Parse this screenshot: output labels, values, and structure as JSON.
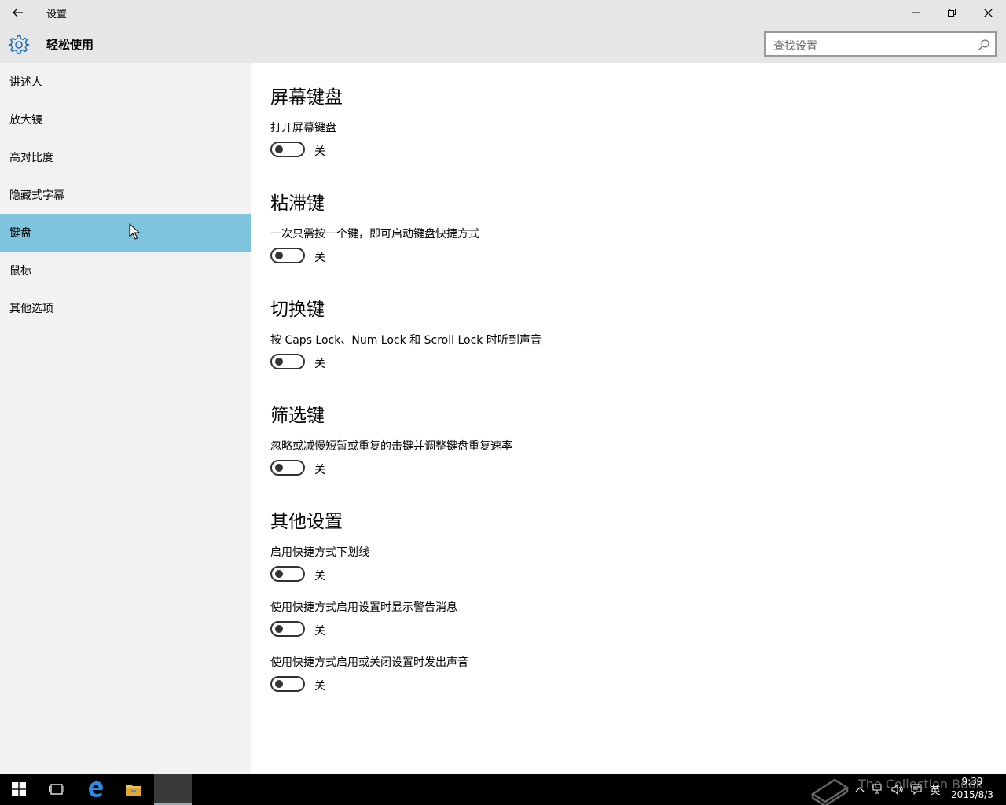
{
  "window": {
    "title": "设置",
    "controls": {
      "minimize": "minimize-icon",
      "maximize": "restore-icon",
      "close": "close-icon"
    }
  },
  "header": {
    "title": "轻松使用",
    "search_placeholder": "查找设置"
  },
  "sidebar": {
    "items": [
      {
        "label": "讲述人",
        "selected": false
      },
      {
        "label": "放大镜",
        "selected": false
      },
      {
        "label": "高对比度",
        "selected": false
      },
      {
        "label": "隐藏式字幕",
        "selected": false
      },
      {
        "label": "键盘",
        "selected": true
      },
      {
        "label": "鼠标",
        "selected": false
      },
      {
        "label": "其他选项",
        "selected": false
      }
    ]
  },
  "content": {
    "sections": [
      {
        "title": "屏幕键盘",
        "options": [
          {
            "label": "打开屏幕键盘",
            "state": "关"
          }
        ]
      },
      {
        "title": "粘滞键",
        "options": [
          {
            "label": "一次只需按一个键，即可启动键盘快捷方式",
            "state": "关"
          }
        ]
      },
      {
        "title": "切换键",
        "options": [
          {
            "label": "按 Caps Lock、Num Lock 和 Scroll Lock 时听到声音",
            "state": "关"
          }
        ]
      },
      {
        "title": "筛选键",
        "options": [
          {
            "label": "忽略或减慢短暂或重复的击键并调整键盘重复速率",
            "state": "关"
          }
        ]
      },
      {
        "title": "其他设置",
        "options": [
          {
            "label": "启用快捷方式下划线",
            "state": "关"
          },
          {
            "label": "使用快捷方式启用设置时显示警告消息",
            "state": "关"
          },
          {
            "label": "使用快捷方式启用或关闭设置时发出声音",
            "state": "关"
          }
        ]
      }
    ]
  },
  "taskbar": {
    "clock_time": "9:39",
    "clock_date": "2015/8/3",
    "ime": "英",
    "watermark": "The Collection Book"
  },
  "colors": {
    "titlebar_bg": "#e6e6e6",
    "sidebar_bg": "#f2f2f2",
    "selected_bg": "#7ec4de",
    "accent": "#1e6fb5",
    "taskbar_bg": "#000000"
  }
}
